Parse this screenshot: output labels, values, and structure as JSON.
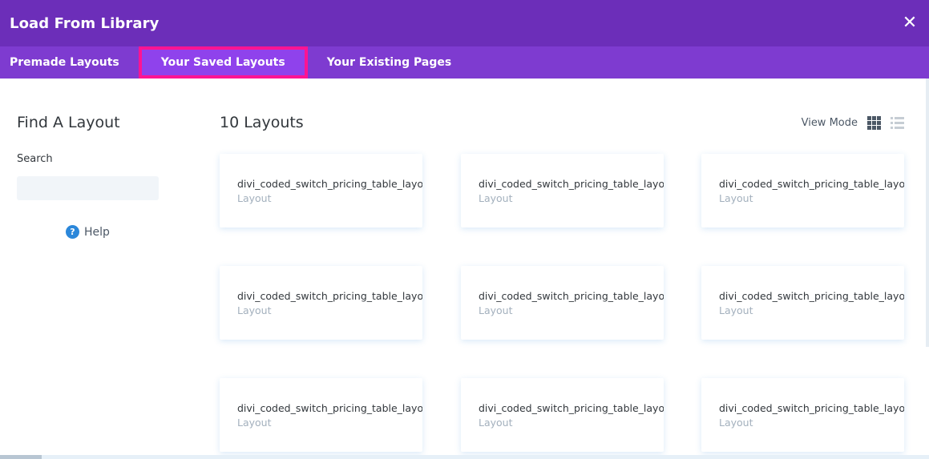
{
  "window": {
    "title": "Load From Library",
    "close_label": "✕"
  },
  "tabs": [
    {
      "label": "Premade Layouts"
    },
    {
      "label": "Your Saved Layouts",
      "active": true
    },
    {
      "label": "Your Existing Pages"
    }
  ],
  "sidebar": {
    "title": "Find A Layout",
    "search_label": "Search",
    "search_value": "",
    "help_icon": "?",
    "help_label": "Help"
  },
  "main": {
    "count_label": "10 Layouts",
    "view_mode_label": "View Mode",
    "view_mode_selected": "grid",
    "cards": [
      {
        "name": "divi_coded_switch_pricing_table_layout",
        "type": "Layout"
      },
      {
        "name": "divi_coded_switch_pricing_table_layout",
        "type": "Layout"
      },
      {
        "name": "divi_coded_switch_pricing_table_layout",
        "type": "Layout"
      },
      {
        "name": "divi_coded_switch_pricing_table_layout",
        "type": "Layout"
      },
      {
        "name": "divi_coded_switch_pricing_table_layout",
        "type": "Layout"
      },
      {
        "name": "divi_coded_switch_pricing_table_layout",
        "type": "Layout"
      },
      {
        "name": "divi_coded_switch_pricing_table_layout",
        "type": "Layout"
      },
      {
        "name": "divi_coded_switch_pricing_table_layout",
        "type": "Layout"
      },
      {
        "name": "divi_coded_switch_pricing_table_layout",
        "type": "Layout"
      }
    ]
  },
  "colors": {
    "header": "#6c2eb9",
    "tabs": "#7e3bd0",
    "active_tab_border": "#ff1493",
    "help_icon": "#2b87da"
  }
}
